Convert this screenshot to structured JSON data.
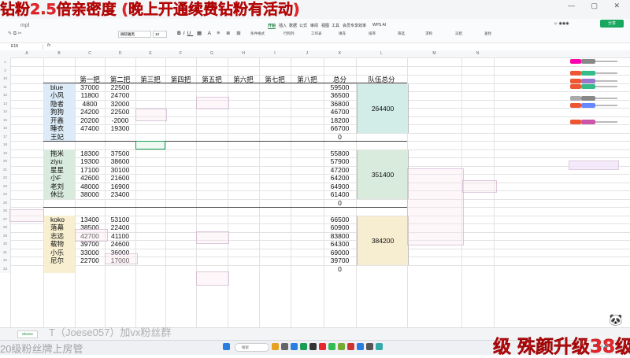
{
  "stream_title": "钻粉2.5倍亲密度 (晚上开通续费钻粉有活动)",
  "file_tab": "mpl",
  "ribbon": {
    "menus": [
      "开始",
      "插入",
      "数据",
      "公式",
      "审阅",
      "视图",
      "工具",
      "会员专享",
      "效率",
      "WPS AI"
    ],
    "active_menu": "开始",
    "font_name": "微软雅黑",
    "font_size": "10",
    "share_label": "分享",
    "tools": [
      "条件格式",
      "行和列",
      "工作表",
      "填充",
      "排序",
      "筛选",
      "求和",
      "冻结",
      "查找"
    ]
  },
  "formula_bar": {
    "cell_ref": "E18",
    "fx": "fx"
  },
  "columns": [
    "A",
    "B",
    "C",
    "D",
    "E",
    "F",
    "G",
    "H",
    "I",
    "J",
    "K",
    "L",
    "M",
    "N"
  ],
  "rows": [
    "1",
    "2",
    "10",
    "11",
    "12",
    "13",
    "14",
    "15",
    "16",
    "17",
    "18",
    "19",
    "20",
    "21",
    "22",
    "23",
    "24",
    "25",
    "26",
    "27",
    "28",
    "29",
    "30",
    "31",
    "32",
    "33"
  ],
  "headers": [
    "第一把",
    "第二把",
    "第三把",
    "第四把",
    "第五把",
    "第六把",
    "第七把",
    "第八把",
    "总分",
    "队伍总分"
  ],
  "teams": [
    {
      "total": "264400",
      "players": [
        {
          "name": "blue",
          "g1": "37000",
          "g2": "22500",
          "sum": "59500"
        },
        {
          "name": "小风",
          "g1": "11800",
          "g2": "24700",
          "sum": "36500"
        },
        {
          "name": "隐者",
          "g1": "4800",
          "g2": "32000",
          "sum": "36800"
        },
        {
          "name": "狗狗",
          "g1": "24200",
          "g2": "22500",
          "sum": "46700"
        },
        {
          "name": "开鑫",
          "g1": "20200",
          "g2": "-2000",
          "sum": "18200"
        },
        {
          "name": "睡衣",
          "g1": "47400",
          "g2": "19300",
          "sum": "66700"
        },
        {
          "name": "王妃",
          "g1": "",
          "g2": "",
          "sum": "0"
        }
      ]
    },
    {
      "total": "351400",
      "players": [
        {
          "name": "拖米",
          "g1": "18300",
          "g2": "37500",
          "sum": "55800"
        },
        {
          "name": "ziyu",
          "g1": "19300",
          "g2": "38600",
          "sum": "57900"
        },
        {
          "name": "星星",
          "g1": "17100",
          "g2": "30100",
          "sum": "47200"
        },
        {
          "name": "小F",
          "g1": "42600",
          "g2": "21600",
          "sum": "64200"
        },
        {
          "name": "老刘",
          "g1": "48000",
          "g2": "16900",
          "sum": "64900"
        },
        {
          "name": "休比",
          "g1": "38000",
          "g2": "23400",
          "sum": "61400"
        },
        {
          "name": "",
          "g1": "",
          "g2": "",
          "sum": "0"
        }
      ]
    },
    {
      "total": "384200",
      "players": [
        {
          "name": "koko",
          "g1": "13400",
          "g2": "53100",
          "sum": "66500"
        },
        {
          "name": "落幕",
          "g1": "38500",
          "g2": "22400",
          "sum": "60900"
        },
        {
          "name": "志远",
          "g1": "42700",
          "g2": "41100",
          "sum": "83800"
        },
        {
          "name": "载物",
          "g1": "39700",
          "g2": "24600",
          "sum": "64300"
        },
        {
          "name": "小乐",
          "g1": "33000",
          "g2": "36000",
          "sum": "69000"
        },
        {
          "name": "尼尔",
          "g1": "22700",
          "g2": "17000",
          "sum": "39700"
        },
        {
          "name": "",
          "g1": "",
          "g2": "",
          "sum": "0"
        }
      ]
    }
  ],
  "sheet_tab": "Sheet1",
  "overlay_watermark": "T（Joese057）加vx粉丝群",
  "bottom_left_text": "20级粉丝牌上房管",
  "bottom_right_text": "级 殊颜升级38级",
  "taskbar_search": "搜索",
  "colors": {
    "stream_red": "#e8262b",
    "team1": "#d2ede7",
    "team2": "#d9ebdc",
    "team3": "#f7edd0",
    "wps_green": "#1aa860"
  }
}
